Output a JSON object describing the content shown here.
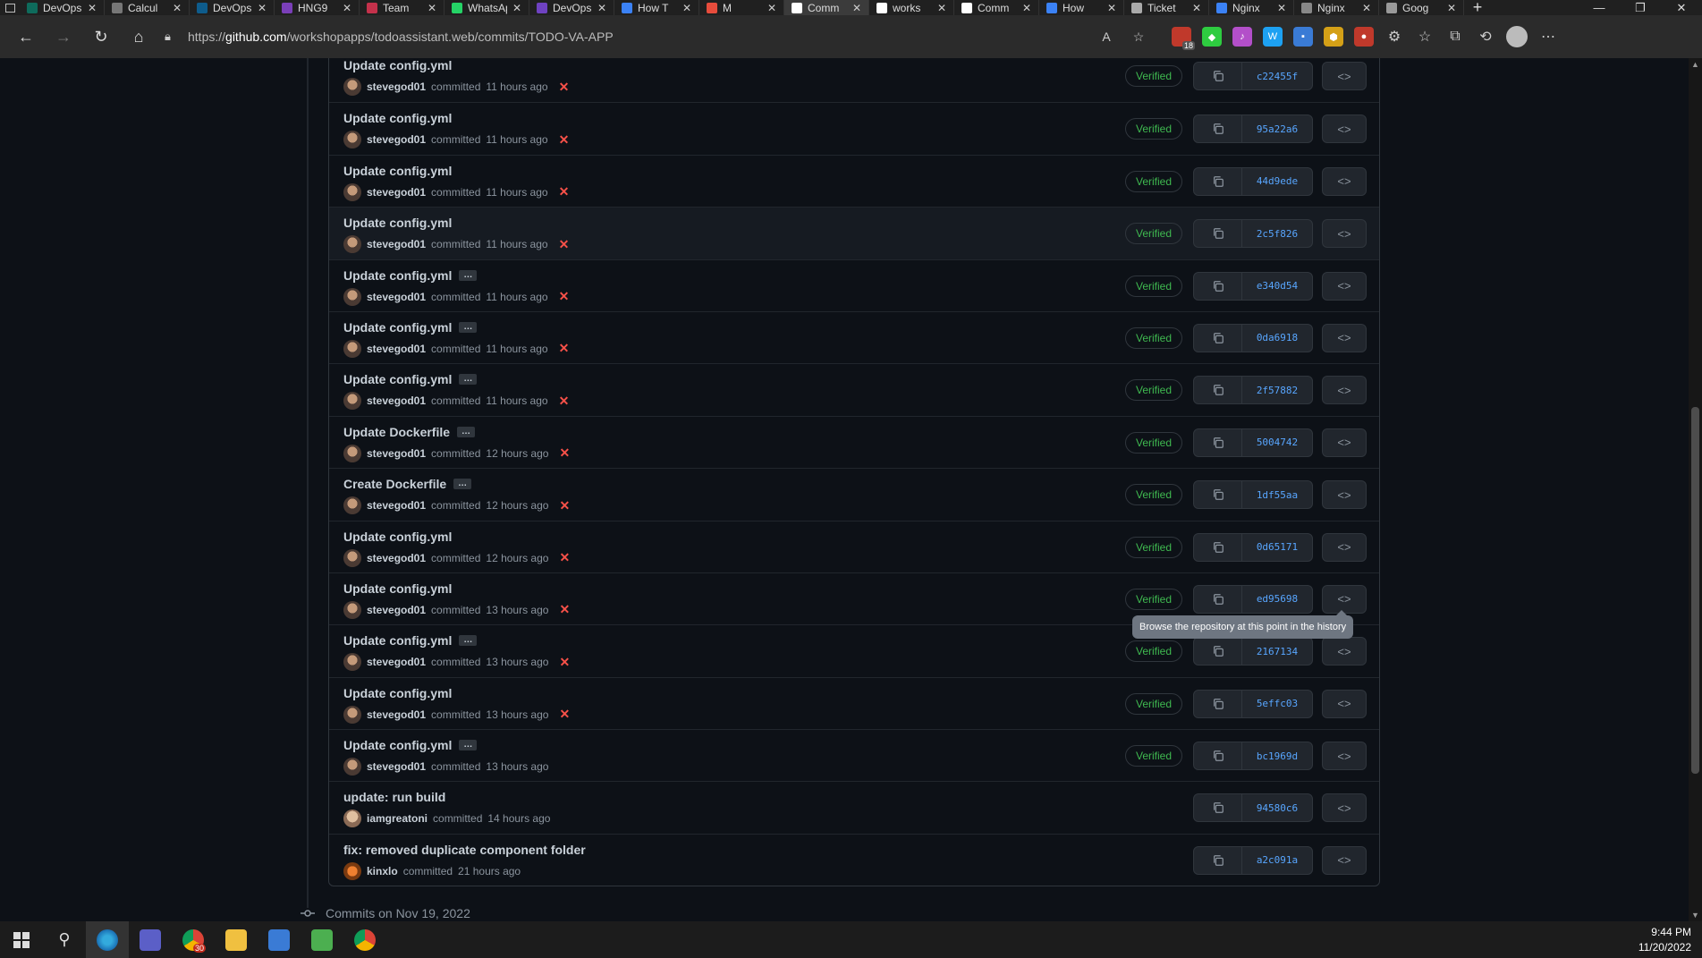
{
  "browser": {
    "tabs": [
      {
        "label": "DevOps",
        "color": "#0e6b5c",
        "active": false
      },
      {
        "label": "Calcul",
        "color": "#777777",
        "active": false
      },
      {
        "label": "DevOps",
        "color": "#0e5c8c",
        "active": false
      },
      {
        "label": "HNG9",
        "color": "#7a3fb8",
        "active": false
      },
      {
        "label": "Team",
        "color": "#c4314b",
        "active": false
      },
      {
        "label": "WhatsApp",
        "color": "#25d366",
        "active": false
      },
      {
        "label": "DevOps",
        "color": "#6f42c1",
        "active": false
      },
      {
        "label": "How T",
        "color": "#3b82f6",
        "active": false
      },
      {
        "label": "M",
        "color": "#e74c3c",
        "active": false
      },
      {
        "label": "Comm",
        "color": "#ffffff",
        "active": true
      },
      {
        "label": "works",
        "color": "#ffffff",
        "active": false
      },
      {
        "label": "Comm",
        "color": "#ffffff",
        "active": false
      },
      {
        "label": "How",
        "color": "#3b82f6",
        "active": false
      },
      {
        "label": "Ticket",
        "color": "#aaaaaa",
        "active": false
      },
      {
        "label": "Nginx",
        "color": "#3b82f6",
        "active": false
      },
      {
        "label": "Nginx",
        "color": "#888888",
        "active": false
      },
      {
        "label": "Goog",
        "color": "#999999",
        "active": false
      }
    ],
    "url_prefix": "https://",
    "url_host": "github.com",
    "url_path": "/workshopapps/todoassistant.web/commits/TODO-VA-APP",
    "ext_badge": "18"
  },
  "commits": [
    {
      "message": "Update config.yml",
      "ellipsis": false,
      "author": "stevegod01",
      "action": "committed",
      "time": "11 hours ago",
      "failed": true,
      "verified": "Verified",
      "sha": "c22455f",
      "avatar": "steve"
    },
    {
      "message": "Update config.yml",
      "ellipsis": false,
      "author": "stevegod01",
      "action": "committed",
      "time": "11 hours ago",
      "failed": true,
      "verified": "Verified",
      "sha": "95a22a6",
      "avatar": "steve"
    },
    {
      "message": "Update config.yml",
      "ellipsis": false,
      "author": "stevegod01",
      "action": "committed",
      "time": "11 hours ago",
      "failed": true,
      "verified": "Verified",
      "sha": "44d9ede",
      "avatar": "steve"
    },
    {
      "message": "Update config.yml",
      "ellipsis": false,
      "author": "stevegod01",
      "action": "committed",
      "time": "11 hours ago",
      "failed": true,
      "verified": "Verified",
      "sha": "2c5f826",
      "avatar": "steve",
      "hover": true
    },
    {
      "message": "Update config.yml",
      "ellipsis": true,
      "author": "stevegod01",
      "action": "committed",
      "time": "11 hours ago",
      "failed": true,
      "verified": "Verified",
      "sha": "e340d54",
      "avatar": "steve"
    },
    {
      "message": "Update config.yml",
      "ellipsis": true,
      "author": "stevegod01",
      "action": "committed",
      "time": "11 hours ago",
      "failed": true,
      "verified": "Verified",
      "sha": "0da6918",
      "avatar": "steve"
    },
    {
      "message": "Update config.yml",
      "ellipsis": true,
      "author": "stevegod01",
      "action": "committed",
      "time": "11 hours ago",
      "failed": true,
      "verified": "Verified",
      "sha": "2f57882",
      "avatar": "steve"
    },
    {
      "message": "Update Dockerfile",
      "ellipsis": true,
      "author": "stevegod01",
      "action": "committed",
      "time": "12 hours ago",
      "failed": true,
      "verified": "Verified",
      "sha": "5004742",
      "avatar": "steve"
    },
    {
      "message": "Create Dockerfile",
      "ellipsis": true,
      "author": "stevegod01",
      "action": "committed",
      "time": "12 hours ago",
      "failed": true,
      "verified": "Verified",
      "sha": "1df55aa",
      "avatar": "steve"
    },
    {
      "message": "Update config.yml",
      "ellipsis": false,
      "author": "stevegod01",
      "action": "committed",
      "time": "12 hours ago",
      "failed": true,
      "verified": "Verified",
      "sha": "0d65171",
      "avatar": "steve"
    },
    {
      "message": "Update config.yml",
      "ellipsis": false,
      "author": "stevegod01",
      "action": "committed",
      "time": "13 hours ago",
      "failed": true,
      "verified": "Verified",
      "sha": "ed95698",
      "avatar": "steve"
    },
    {
      "message": "Update config.yml",
      "ellipsis": true,
      "author": "stevegod01",
      "action": "committed",
      "time": "13 hours ago",
      "failed": true,
      "verified": "Verified",
      "sha": "2167134",
      "avatar": "steve"
    },
    {
      "message": "Update config.yml",
      "ellipsis": false,
      "author": "stevegod01",
      "action": "committed",
      "time": "13 hours ago",
      "failed": true,
      "verified": "Verified",
      "sha": "5effc03",
      "avatar": "steve"
    },
    {
      "message": "Update config.yml",
      "ellipsis": true,
      "author": "stevegod01",
      "action": "committed",
      "time": "13 hours ago",
      "failed": false,
      "verified": "Verified",
      "sha": "bc1969d",
      "avatar": "steve"
    },
    {
      "message": "update: run build",
      "ellipsis": false,
      "author": "iamgreatoni",
      "action": "committed",
      "time": "14 hours ago",
      "failed": false,
      "verified": "",
      "sha": "94580c6",
      "avatar": "alt"
    },
    {
      "message": "fix: removed duplicate component folder",
      "ellipsis": false,
      "author": "kinxlo",
      "action": "committed",
      "time": "21 hours ago",
      "failed": false,
      "verified": "",
      "sha": "a2c091a",
      "avatar": "fox"
    }
  ],
  "tooltip": "Browse the repository at this point in the history",
  "date_heading": "Commits on Nov 19, 2022",
  "taskbar": {
    "time": "9:44 PM",
    "date": "11/20/2022",
    "badge": "30"
  }
}
